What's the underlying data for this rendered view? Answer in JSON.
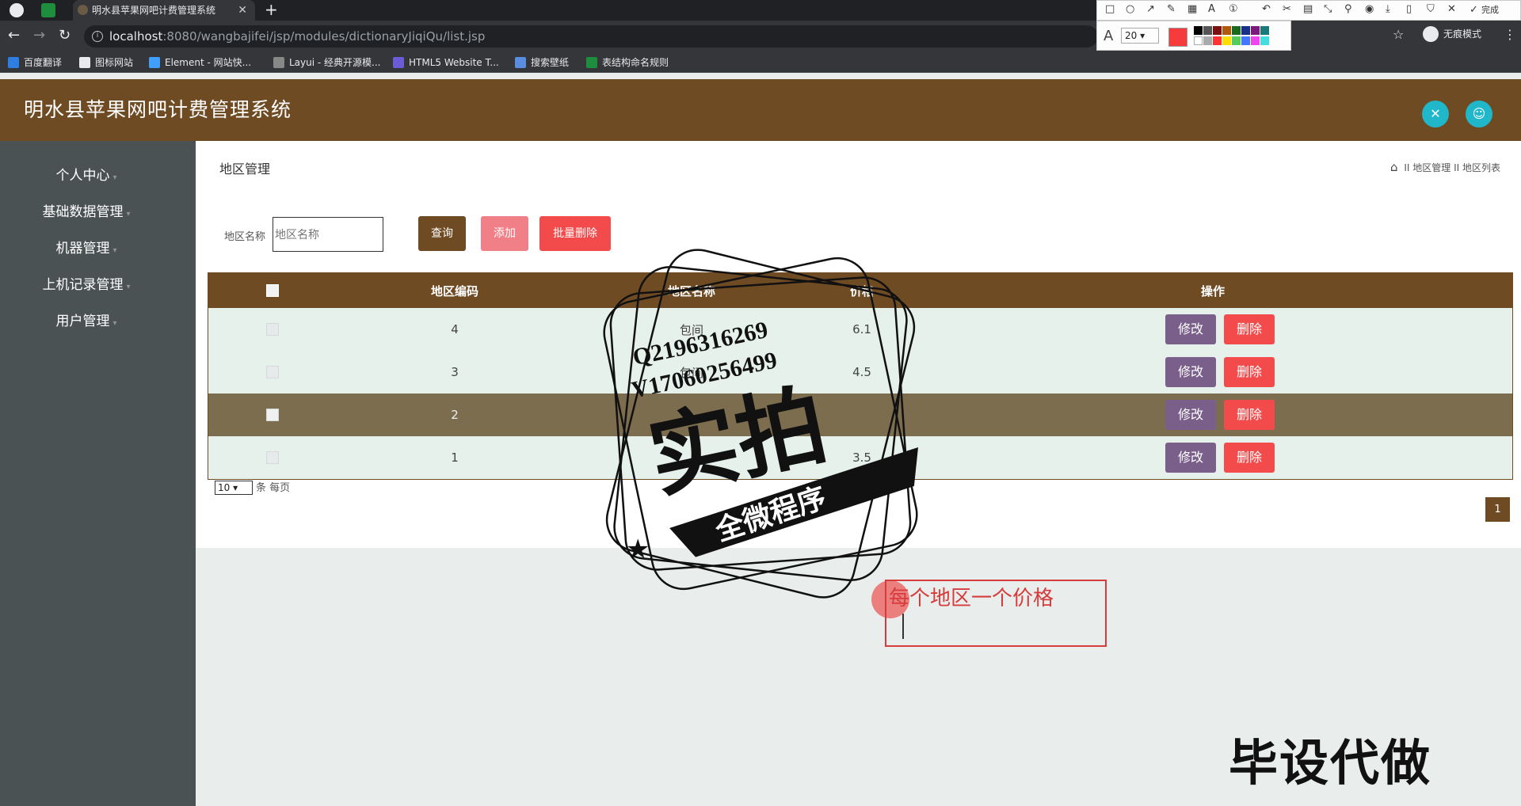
{
  "browser": {
    "tab_title": "明水县苹果网吧计费管理系统",
    "url_host": "localhost",
    "url_path": ":8080/wangbajifei/jsp/modules/dictionaryJiqiQu/list.jsp",
    "incognito_label": "无痕模式",
    "bookmarks": [
      "百度翻译",
      "图标网站",
      "Element - 网站快...",
      "Layui - 经典开源模...",
      "HTML5 Website T...",
      "搜索壁纸",
      "表结构命名规则"
    ]
  },
  "snip_tool": {
    "done_label": "完成",
    "font_size": "20"
  },
  "app": {
    "title": "明水县苹果网吧计费管理系统"
  },
  "sidebar": {
    "items": [
      {
        "label": "个人中心"
      },
      {
        "label": "基础数据管理"
      },
      {
        "label": "机器管理"
      },
      {
        "label": "上机记录管理"
      },
      {
        "label": "用户管理"
      }
    ]
  },
  "page": {
    "title": "地区管理",
    "breadcrumb_1": "地区管理",
    "breadcrumb_2": "地区列表",
    "breadcrumb_sep": "II"
  },
  "search": {
    "label": "地区名称",
    "placeholder": "地区名称",
    "query_button": "查询",
    "add_button": "添加",
    "batch_delete_button": "批量删除"
  },
  "table": {
    "headers": {
      "code": "地区编码",
      "name": "地区名称",
      "price": "价格",
      "ops": "操作"
    },
    "rows": [
      {
        "code": "4",
        "name": "包间",
        "price": "6.1"
      },
      {
        "code": "3",
        "name": "包间",
        "price": "4.5"
      },
      {
        "code": "2",
        "name": "",
        "price": ""
      },
      {
        "code": "1",
        "name": "",
        "price": "3.5"
      }
    ],
    "edit_label": "修改",
    "delete_label": "删除"
  },
  "pagination": {
    "page_size": "10",
    "per_page_label": "条 每页",
    "current_page": "1"
  },
  "annotation": {
    "text": "每个地区一个价格"
  },
  "watermark": {
    "qq": "Q2196316269",
    "wx": "V17060256499",
    "big": "实拍",
    "ribbon": "全微程序",
    "footer": "毕设代做"
  },
  "colors": {
    "header_brown": "#6f4b24",
    "sidebar_gray": "#4b5254",
    "edit_purple": "#7a5f8a",
    "delete_red": "#f34b4b",
    "add_pink": "#f07f87",
    "accent_cyan": "#1fb7c9"
  }
}
